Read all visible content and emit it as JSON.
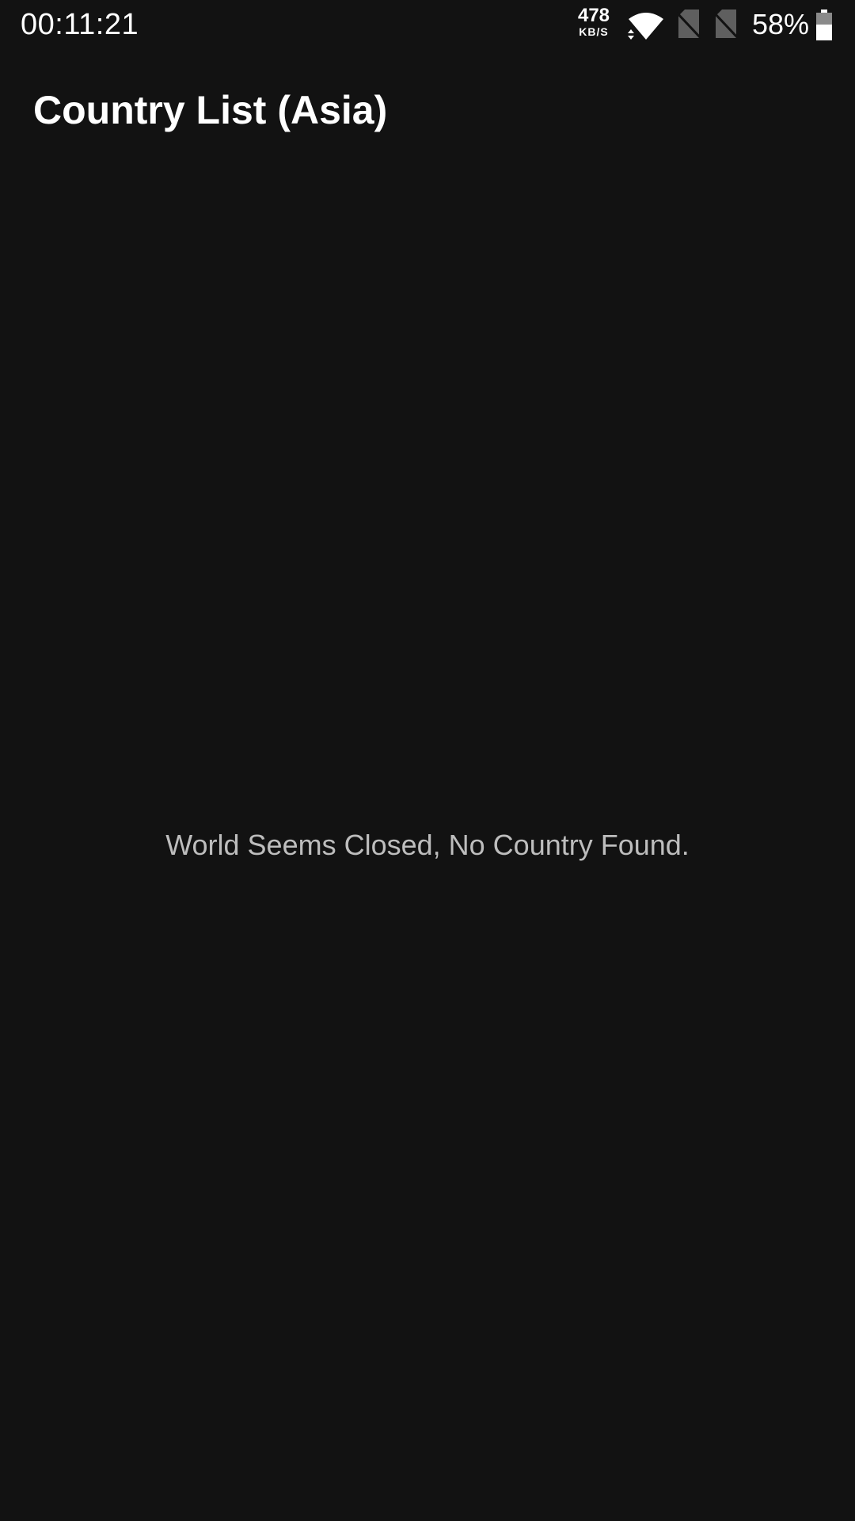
{
  "status_bar": {
    "time": "00:11:21",
    "net_speed_value": "478",
    "net_speed_unit": "KB/S",
    "battery_percent": "58%",
    "battery_level": 0.58,
    "icons": [
      "wifi-icon",
      "sim-off-icon",
      "sim-off-icon",
      "battery-icon"
    ]
  },
  "app_bar": {
    "title": "Country List (Asia)"
  },
  "content": {
    "empty_message": "World Seems Closed, No Country Found."
  },
  "colors": {
    "background": "#121212",
    "primary_text": "#ffffff",
    "secondary_text": "#bdbdbd"
  }
}
